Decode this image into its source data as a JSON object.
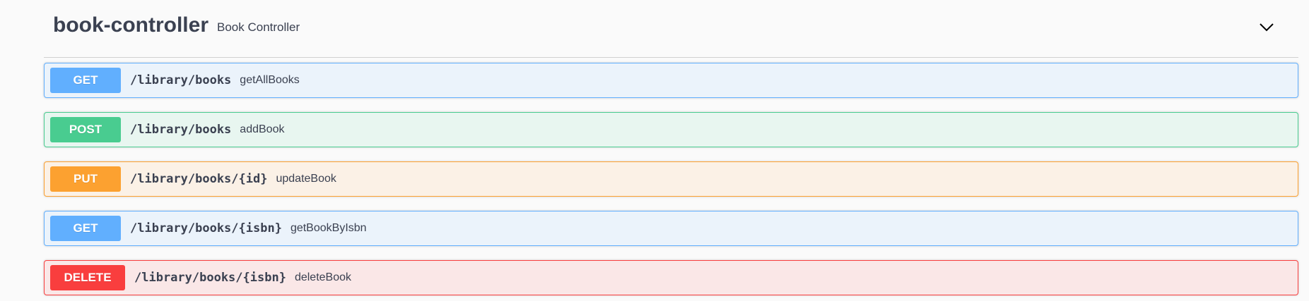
{
  "tag": {
    "name": "book-controller",
    "description": "Book Controller",
    "toggle_icon": "chevron-down-icon"
  },
  "colors": {
    "get": "#61affe",
    "post": "#49cc90",
    "put": "#fca130",
    "delete": "#f93e3e"
  },
  "operations": [
    {
      "method": "GET",
      "path": "/library/books",
      "summary": "getAllBooks"
    },
    {
      "method": "POST",
      "path": "/library/books",
      "summary": "addBook"
    },
    {
      "method": "PUT",
      "path": "/library/books/{id}",
      "summary": "updateBook"
    },
    {
      "method": "GET",
      "path": "/library/books/{isbn}",
      "summary": "getBookByIsbn"
    },
    {
      "method": "DELETE",
      "path": "/library/books/{isbn}",
      "summary": "deleteBook"
    }
  ]
}
